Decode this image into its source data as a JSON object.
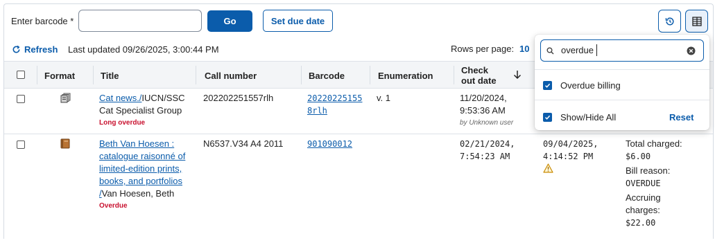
{
  "toolbar": {
    "barcode_label": "Enter barcode",
    "required_mark": "*",
    "barcode_value": "",
    "go_label": "Go",
    "due_date_label": "Set due date"
  },
  "status": {
    "refresh_label": "Refresh",
    "last_updated": "Last updated 09/26/2025, 3:00:44 PM",
    "rows_per_page_label": "Rows per page:",
    "rows_per_page_value": "10"
  },
  "table": {
    "headers": {
      "format": "Format",
      "title": "Title",
      "call_number": "Call number",
      "barcode": "Barcode",
      "enumeration": "Enumeration",
      "checkout_line1": "Check",
      "checkout_line2": "out date"
    },
    "rows": [
      {
        "format_icon": "serial-icon",
        "title_link": "Cat news./",
        "title_rest": "IUCN/SSC",
        "author": "Cat Specialist Group",
        "status": "Long overdue",
        "call_number": "202202251557rlh",
        "barcode_line1": "20220225155",
        "barcode_line2": "8rlh",
        "enumeration": "v. 1",
        "checkout_date": "11/20/2024,",
        "checkout_time": "9:53:36 AM",
        "checkout_by": "by Unknown user"
      },
      {
        "format_icon": "book-icon",
        "title_lines": [
          "Beth Van Hoesen :",
          "catalogue raisonné of",
          "limited-edition prints,",
          "books, and portfolios"
        ],
        "title_slash": "/",
        "author": "Van Hoesen, Beth",
        "status": "Overdue",
        "call_number": "N6537.V34 A4 2011",
        "barcode": "901090012",
        "checkout_date": "02/21/2024,",
        "checkout_time": "7:54:23 AM",
        "due_date": "09/04/2025,",
        "due_time": "4:14:52 PM",
        "warning_icon": "warning-icon",
        "fines": [
          "Total charged:",
          "$6.00",
          "Bill reason:",
          "OVERDUE",
          "Accruing",
          "charges:",
          "$22.00"
        ]
      }
    ]
  },
  "column_picker": {
    "search_value": "overdue",
    "option_label": "Overdue billing",
    "show_hide_label": "Show/Hide All",
    "reset_label": "Reset"
  },
  "colors": {
    "accent": "#0b5cab",
    "danger": "#c8102e",
    "header_bg": "#f3f5f7"
  }
}
